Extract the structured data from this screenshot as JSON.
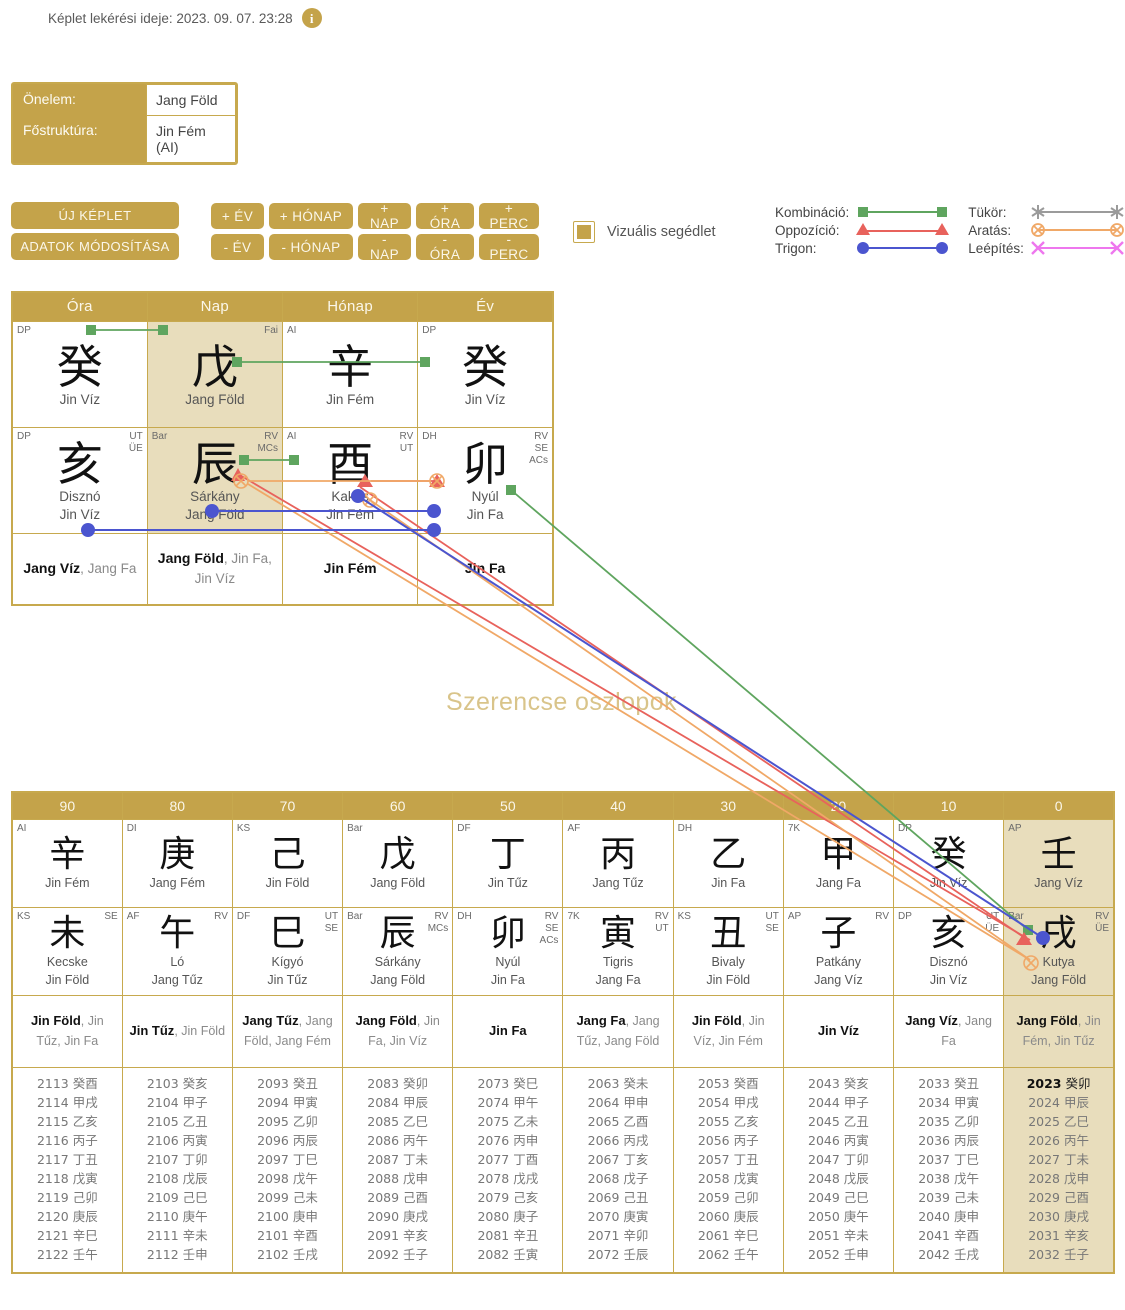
{
  "header": {
    "timestamp_label": "Képlet lekérési ideje: 2023. 09. 07. 23:28",
    "info_icon": "info-icon"
  },
  "infobox": {
    "rows": [
      {
        "label": "Önelem:",
        "value": "Jang Föld"
      },
      {
        "label": "Főstruktúra:",
        "value": "Jin Fém (AI)"
      }
    ]
  },
  "buttons": {
    "new_chart": "ÚJ KÉPLET",
    "modify_data": "ADATOK MÓDOSÍTÁSA",
    "plus": [
      "+ ÉV",
      "+ HÓNAP",
      "+ NAP",
      "+ ÓRA",
      "+ PERC"
    ],
    "minus": [
      "- ÉV",
      "- HÓNAP",
      "- NAP",
      "- ÓRA",
      "- PERC"
    ]
  },
  "visual_aid": {
    "label": "Vizuális segédlet",
    "checked": true
  },
  "legend": {
    "items": [
      {
        "label": "Kombináció:",
        "color": "#5fa55f",
        "marker": "square"
      },
      {
        "label": "Tükör:",
        "color": "#9b9b9b",
        "marker": "asterisk"
      },
      {
        "label": "Oppozíció:",
        "color": "#e8625c",
        "marker": "triangle"
      },
      {
        "label": "Aratás:",
        "color": "#f0a867",
        "marker": "crossed-circle"
      },
      {
        "label": "Trigon:",
        "color": "#4b55cf",
        "marker": "circle"
      },
      {
        "label": "Leépítés:",
        "color": "#ee77ee",
        "marker": "x"
      }
    ]
  },
  "bazi": {
    "columns": [
      "Óra",
      "Nap",
      "Hónap",
      "Év"
    ],
    "stems": [
      {
        "tl": "DP",
        "tr": "",
        "glyph": "癸",
        "name": "Jin Víz",
        "highlight": false
      },
      {
        "tl": "",
        "tr": "Fai",
        "glyph": "戊",
        "name": "Jang Föld",
        "highlight": true
      },
      {
        "tl": "AI",
        "tr": "",
        "glyph": "辛",
        "name": "Jin Fém",
        "highlight": false
      },
      {
        "tl": "DP",
        "tr": "",
        "glyph": "癸",
        "name": "Jin Víz",
        "highlight": false
      }
    ],
    "branches": [
      {
        "tl": "DP",
        "tr": "UT\nÜE",
        "glyph": "亥",
        "animal": "Disznó",
        "name": "Jin Víz"
      },
      {
        "tl": "Bar",
        "tr": "RV\nMCs",
        "glyph": "辰",
        "animal": "Sárkány",
        "name": "Jang Föld"
      },
      {
        "tl": "AI",
        "tr": "RV\nUT",
        "glyph": "酉",
        "animal": "Kakas",
        "name": "Jin Fém"
      },
      {
        "tl": "DH",
        "tr": "RV\nSE\nACs",
        "glyph": "卯",
        "animal": "Nyúl",
        "name": "Jin Fa"
      }
    ],
    "elements": [
      {
        "main": "Jang Víz",
        "rest": ", Jang Fa"
      },
      {
        "main": "Jang Föld",
        "rest": ", Jin Fa, Jin Víz"
      },
      {
        "main": "Jin Fém",
        "rest": ""
      },
      {
        "main": "Jin Fa",
        "rest": ""
      }
    ]
  },
  "section_title": "Szerencse oszlopok",
  "luck": {
    "ages": [
      "90",
      "80",
      "70",
      "60",
      "50",
      "40",
      "30",
      "20",
      "10",
      "0"
    ],
    "stems": [
      {
        "tl": "AI",
        "glyph": "辛",
        "name": "Jin Fém",
        "highlight": false
      },
      {
        "tl": "DI",
        "glyph": "庚",
        "name": "Jang Fém",
        "highlight": false
      },
      {
        "tl": "KS",
        "glyph": "己",
        "name": "Jin Föld",
        "highlight": false
      },
      {
        "tl": "Bar",
        "glyph": "戊",
        "name": "Jang Föld",
        "highlight": false
      },
      {
        "tl": "DF",
        "glyph": "丁",
        "name": "Jin Tűz",
        "highlight": false
      },
      {
        "tl": "AF",
        "glyph": "丙",
        "name": "Jang Tűz",
        "highlight": false
      },
      {
        "tl": "DH",
        "glyph": "乙",
        "name": "Jin Fa",
        "highlight": false
      },
      {
        "tl": "7K",
        "glyph": "甲",
        "name": "Jang Fa",
        "highlight": false
      },
      {
        "tl": "DP",
        "glyph": "癸",
        "name": "Jin Víz",
        "highlight": false
      },
      {
        "tl": "AP",
        "glyph": "壬",
        "name": "Jang Víz",
        "highlight": true
      }
    ],
    "branches": [
      {
        "tl": "KS",
        "tr": "SE",
        "glyph": "未",
        "animal": "Kecske",
        "name": "Jin Föld",
        "highlight": false
      },
      {
        "tl": "AF",
        "tr": "RV",
        "glyph": "午",
        "animal": "Ló",
        "name": "Jang Tűz",
        "highlight": false
      },
      {
        "tl": "DF",
        "tr": "UT\nSE",
        "glyph": "巳",
        "animal": "Kígyó",
        "name": "Jin Tűz",
        "highlight": false
      },
      {
        "tl": "Bar",
        "tr": "RV\nMCs",
        "glyph": "辰",
        "animal": "Sárkány",
        "name": "Jang Föld",
        "highlight": false
      },
      {
        "tl": "DH",
        "tr": "RV\nSE\nACs",
        "glyph": "卯",
        "animal": "Nyúl",
        "name": "Jin Fa",
        "highlight": false
      },
      {
        "tl": "7K",
        "tr": "RV\nUT",
        "glyph": "寅",
        "animal": "Tigris",
        "name": "Jang Fa",
        "highlight": false
      },
      {
        "tl": "KS",
        "tr": "UT\nSE",
        "glyph": "丑",
        "animal": "Bivaly",
        "name": "Jin Föld",
        "highlight": false
      },
      {
        "tl": "AP",
        "tr": "RV",
        "glyph": "子",
        "animal": "Patkány",
        "name": "Jang Víz",
        "highlight": false
      },
      {
        "tl": "DP",
        "tr": "UT\nÜE",
        "glyph": "亥",
        "animal": "Disznó",
        "name": "Jin Víz",
        "highlight": false
      },
      {
        "tl": "Bar",
        "tr": "RV\nÜE",
        "glyph": "戌",
        "animal": "Kutya",
        "name": "Jang Föld",
        "highlight": true
      }
    ],
    "elements": [
      {
        "main": "Jin Föld",
        "rest": ", Jin Tűz, Jin Fa",
        "highlight": false
      },
      {
        "main": "Jin Tűz",
        "rest": ", Jin Föld",
        "highlight": false
      },
      {
        "main": "Jang Tűz",
        "rest": ", Jang Föld, Jang Fém",
        "highlight": false
      },
      {
        "main": "Jang Föld",
        "rest": ", Jin Fa, Jin Víz",
        "highlight": false
      },
      {
        "main": "Jin Fa",
        "rest": "",
        "highlight": false
      },
      {
        "main": "Jang Fa",
        "rest": ", Jang Tűz, Jang Föld",
        "highlight": false
      },
      {
        "main": "Jin Föld",
        "rest": ", Jin Víz, Jin Fém",
        "highlight": false
      },
      {
        "main": "Jin Víz",
        "rest": "",
        "highlight": false
      },
      {
        "main": "Jang Víz",
        "rest": ", Jang Fa",
        "highlight": false
      },
      {
        "main": "Jang Föld",
        "rest": ", Jin Fém, Jin Tűz",
        "highlight": true
      }
    ],
    "year_columns": [
      {
        "highlight": false,
        "years": [
          {
            "y": "2113",
            "g": "癸酉"
          },
          {
            "y": "2114",
            "g": "甲戌"
          },
          {
            "y": "2115",
            "g": "乙亥"
          },
          {
            "y": "2116",
            "g": "丙子"
          },
          {
            "y": "2117",
            "g": "丁丑"
          },
          {
            "y": "2118",
            "g": "戊寅"
          },
          {
            "y": "2119",
            "g": "己卯"
          },
          {
            "y": "2120",
            "g": "庚辰"
          },
          {
            "y": "2121",
            "g": "辛巳"
          },
          {
            "y": "2122",
            "g": "壬午"
          }
        ]
      },
      {
        "highlight": false,
        "years": [
          {
            "y": "2103",
            "g": "癸亥"
          },
          {
            "y": "2104",
            "g": "甲子"
          },
          {
            "y": "2105",
            "g": "乙丑"
          },
          {
            "y": "2106",
            "g": "丙寅"
          },
          {
            "y": "2107",
            "g": "丁卯"
          },
          {
            "y": "2108",
            "g": "戊辰"
          },
          {
            "y": "2109",
            "g": "己巳"
          },
          {
            "y": "2110",
            "g": "庚午"
          },
          {
            "y": "2111",
            "g": "辛未"
          },
          {
            "y": "2112",
            "g": "壬申"
          }
        ]
      },
      {
        "highlight": false,
        "years": [
          {
            "y": "2093",
            "g": "癸丑"
          },
          {
            "y": "2094",
            "g": "甲寅"
          },
          {
            "y": "2095",
            "g": "乙卯"
          },
          {
            "y": "2096",
            "g": "丙辰"
          },
          {
            "y": "2097",
            "g": "丁巳"
          },
          {
            "y": "2098",
            "g": "戊午"
          },
          {
            "y": "2099",
            "g": "己未"
          },
          {
            "y": "2100",
            "g": "庚申"
          },
          {
            "y": "2101",
            "g": "辛酉"
          },
          {
            "y": "2102",
            "g": "壬戌"
          }
        ]
      },
      {
        "highlight": false,
        "years": [
          {
            "y": "2083",
            "g": "癸卯"
          },
          {
            "y": "2084",
            "g": "甲辰"
          },
          {
            "y": "2085",
            "g": "乙巳"
          },
          {
            "y": "2086",
            "g": "丙午"
          },
          {
            "y": "2087",
            "g": "丁未"
          },
          {
            "y": "2088",
            "g": "戊申"
          },
          {
            "y": "2089",
            "g": "己酉"
          },
          {
            "y": "2090",
            "g": "庚戌"
          },
          {
            "y": "2091",
            "g": "辛亥"
          },
          {
            "y": "2092",
            "g": "壬子"
          }
        ]
      },
      {
        "highlight": false,
        "years": [
          {
            "y": "2073",
            "g": "癸巳"
          },
          {
            "y": "2074",
            "g": "甲午"
          },
          {
            "y": "2075",
            "g": "乙未"
          },
          {
            "y": "2076",
            "g": "丙申"
          },
          {
            "y": "2077",
            "g": "丁酉"
          },
          {
            "y": "2078",
            "g": "戊戌"
          },
          {
            "y": "2079",
            "g": "己亥"
          },
          {
            "y": "2080",
            "g": "庚子"
          },
          {
            "y": "2081",
            "g": "辛丑"
          },
          {
            "y": "2082",
            "g": "壬寅"
          }
        ]
      },
      {
        "highlight": false,
        "years": [
          {
            "y": "2063",
            "g": "癸未"
          },
          {
            "y": "2064",
            "g": "甲申"
          },
          {
            "y": "2065",
            "g": "乙酉"
          },
          {
            "y": "2066",
            "g": "丙戌"
          },
          {
            "y": "2067",
            "g": "丁亥"
          },
          {
            "y": "2068",
            "g": "戊子"
          },
          {
            "y": "2069",
            "g": "己丑"
          },
          {
            "y": "2070",
            "g": "庚寅"
          },
          {
            "y": "2071",
            "g": "辛卯"
          },
          {
            "y": "2072",
            "g": "壬辰"
          }
        ]
      },
      {
        "highlight": false,
        "years": [
          {
            "y": "2053",
            "g": "癸酉"
          },
          {
            "y": "2054",
            "g": "甲戌"
          },
          {
            "y": "2055",
            "g": "乙亥"
          },
          {
            "y": "2056",
            "g": "丙子"
          },
          {
            "y": "2057",
            "g": "丁丑"
          },
          {
            "y": "2058",
            "g": "戊寅"
          },
          {
            "y": "2059",
            "g": "己卯"
          },
          {
            "y": "2060",
            "g": "庚辰"
          },
          {
            "y": "2061",
            "g": "辛巳"
          },
          {
            "y": "2062",
            "g": "壬午"
          }
        ]
      },
      {
        "highlight": false,
        "years": [
          {
            "y": "2043",
            "g": "癸亥"
          },
          {
            "y": "2044",
            "g": "甲子"
          },
          {
            "y": "2045",
            "g": "乙丑"
          },
          {
            "y": "2046",
            "g": "丙寅"
          },
          {
            "y": "2047",
            "g": "丁卯"
          },
          {
            "y": "2048",
            "g": "戊辰"
          },
          {
            "y": "2049",
            "g": "己巳"
          },
          {
            "y": "2050",
            "g": "庚午"
          },
          {
            "y": "2051",
            "g": "辛未"
          },
          {
            "y": "2052",
            "g": "壬申"
          }
        ]
      },
      {
        "highlight": false,
        "years": [
          {
            "y": "2033",
            "g": "癸丑"
          },
          {
            "y": "2034",
            "g": "甲寅"
          },
          {
            "y": "2035",
            "g": "乙卯"
          },
          {
            "y": "2036",
            "g": "丙辰"
          },
          {
            "y": "2037",
            "g": "丁巳"
          },
          {
            "y": "2038",
            "g": "戊午"
          },
          {
            "y": "2039",
            "g": "己未"
          },
          {
            "y": "2040",
            "g": "庚申"
          },
          {
            "y": "2041",
            "g": "辛酉"
          },
          {
            "y": "2042",
            "g": "壬戌"
          }
        ]
      },
      {
        "highlight": true,
        "current": "2023",
        "years": [
          {
            "y": "2023",
            "g": "癸卯"
          },
          {
            "y": "2024",
            "g": "甲辰"
          },
          {
            "y": "2025",
            "g": "乙巳"
          },
          {
            "y": "2026",
            "g": "丙午"
          },
          {
            "y": "2027",
            "g": "丁未"
          },
          {
            "y": "2028",
            "g": "戊申"
          },
          {
            "y": "2029",
            "g": "己酉"
          },
          {
            "y": "2030",
            "g": "庚戌"
          },
          {
            "y": "2031",
            "g": "辛亥"
          },
          {
            "y": "2032",
            "g": "壬子"
          }
        ]
      }
    ]
  },
  "colors": {
    "gold": "#c4a34a",
    "gold_border": "#c7a94e",
    "highlight_bg": "#e8ddbc",
    "combination": "#5fa55f",
    "opposition": "#e8625c",
    "trigon": "#4b55cf",
    "mirror": "#9b9b9b",
    "harvest": "#f0a867",
    "degradation": "#ee77ee"
  }
}
